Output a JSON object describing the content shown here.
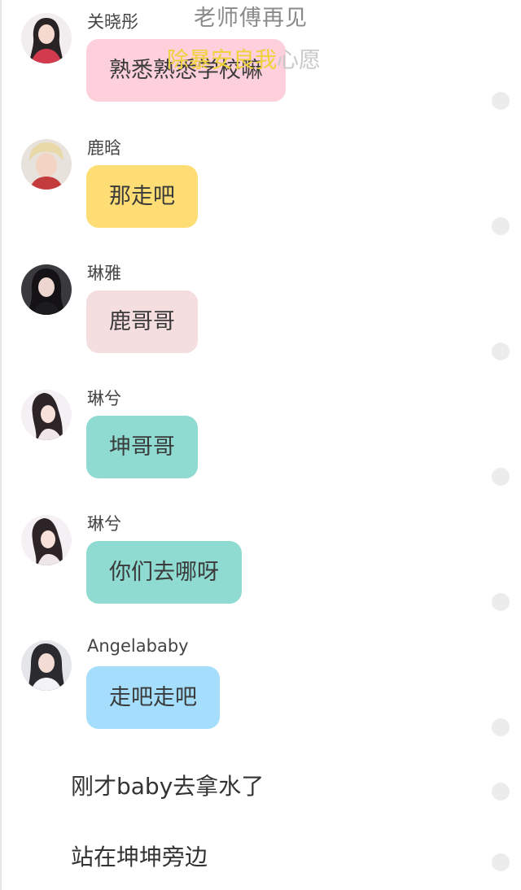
{
  "overlay": {
    "top_caption": "老师傅再见",
    "yellow_caption": "除暴安良我",
    "yellow_caption_tail": "心愿"
  },
  "messages": [
    {
      "sender": "关晓彤",
      "text": "熟悉熟悉学校嘛",
      "bubble_color": "#fdd0dc"
    },
    {
      "sender": "鹿晗",
      "text": "那走吧",
      "bubble_color": "#fede74"
    },
    {
      "sender": "琳雅",
      "text": "鹿哥哥",
      "bubble_color": "#f4dedf"
    },
    {
      "sender": "琳兮",
      "text": "坤哥哥",
      "bubble_color": "#8fdbd2"
    },
    {
      "sender": "琳兮",
      "text": "你们去哪呀",
      "bubble_color": "#8fdbd2"
    },
    {
      "sender": "Angelababy",
      "text": "走吧走吧",
      "bubble_color": "#a5ddfd"
    }
  ],
  "narration": [
    {
      "text": "刚才baby去拿水了"
    },
    {
      "text": "站在坤坤旁边"
    }
  ]
}
